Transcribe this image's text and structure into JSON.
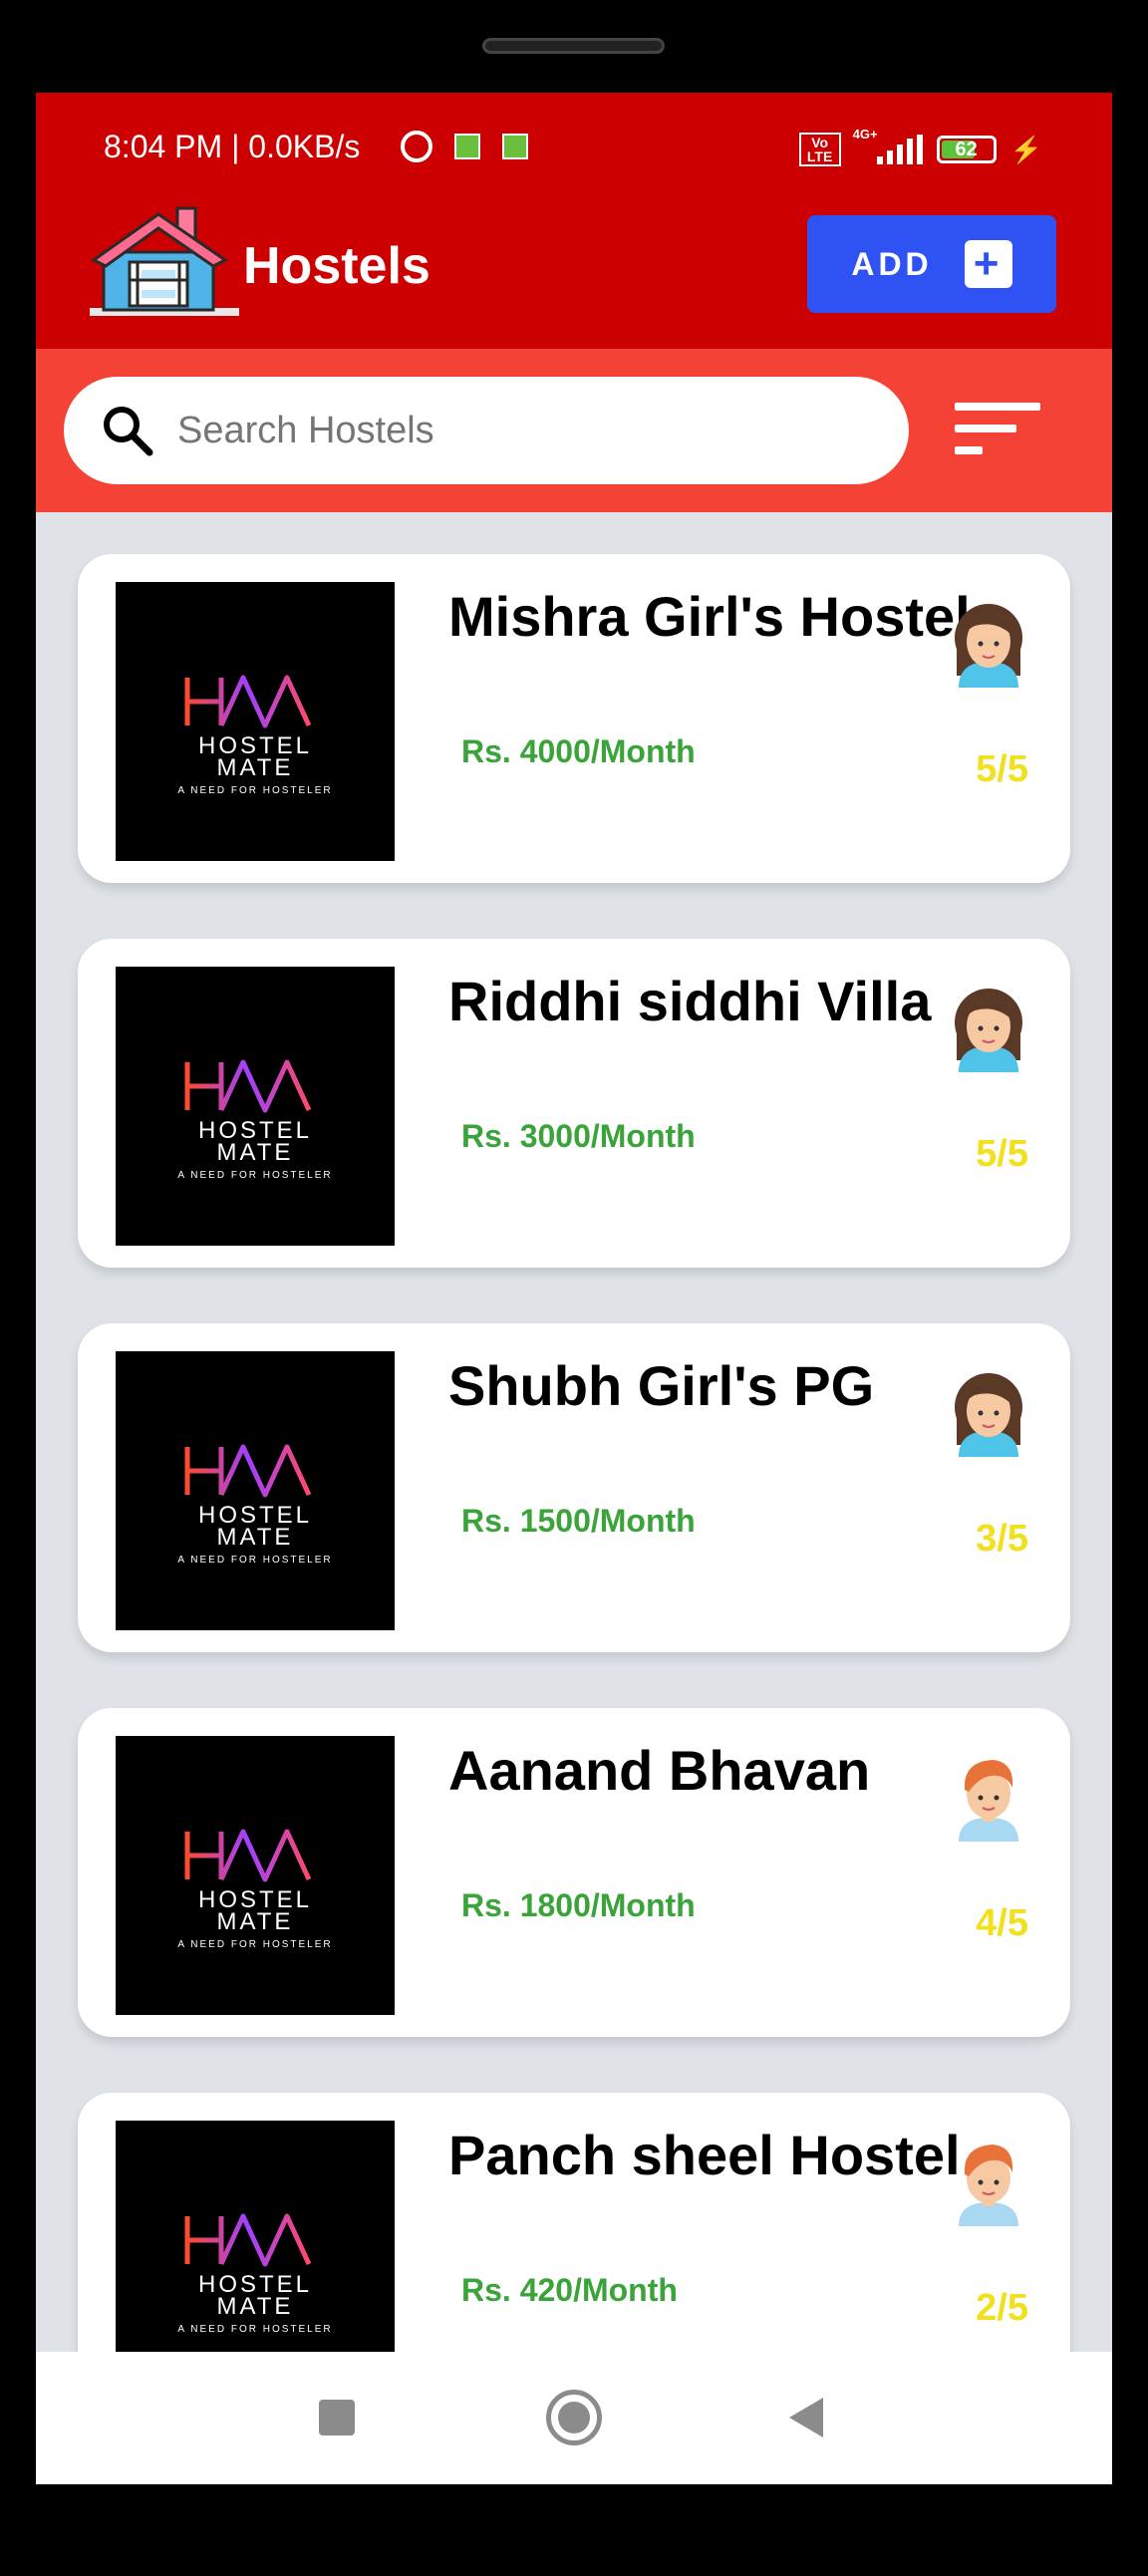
{
  "status_bar": {
    "time_speed": "8:04 PM | 0.0KB/s",
    "network_label": "Vo LTE",
    "network_type": "4G+",
    "battery_level": "62"
  },
  "header": {
    "title": "Hostels",
    "add_label": "ADD",
    "logo_icon": "house-bunkbed-icon"
  },
  "search": {
    "placeholder": "Search Hostels",
    "filter_icon": "filter-icon"
  },
  "thumb_text": {
    "monogram": "HM",
    "line1": "HOSTEL",
    "line2": "MATE",
    "tagline": "A NEED FOR HOSTELER"
  },
  "hostels": [
    {
      "name": "Mishra Girl's Hostel",
      "price": "Rs. 4000/Month",
      "rating": "5/5",
      "gender_icon": "girl-avatar-icon"
    },
    {
      "name": "Riddhi siddhi Villa",
      "price": "Rs. 3000/Month",
      "rating": "5/5",
      "gender_icon": "girl-avatar-icon"
    },
    {
      "name": "Shubh Girl's PG",
      "price": "Rs. 1500/Month",
      "rating": "3/5",
      "gender_icon": "girl-avatar-icon"
    },
    {
      "name": "Aanand Bhavan",
      "price": "Rs. 1800/Month",
      "rating": "4/5",
      "gender_icon": "boy-avatar-icon"
    },
    {
      "name": "Panch sheel Hostel",
      "price": "Rs. 420/Month",
      "rating": "2/5",
      "gender_icon": "boy-avatar-icon"
    }
  ],
  "colors": {
    "appbar": "#cc0000",
    "searchbar": "#f44336",
    "add_button": "#2f52f2",
    "price": "#3aa33a",
    "rating": "#f2e01e"
  }
}
